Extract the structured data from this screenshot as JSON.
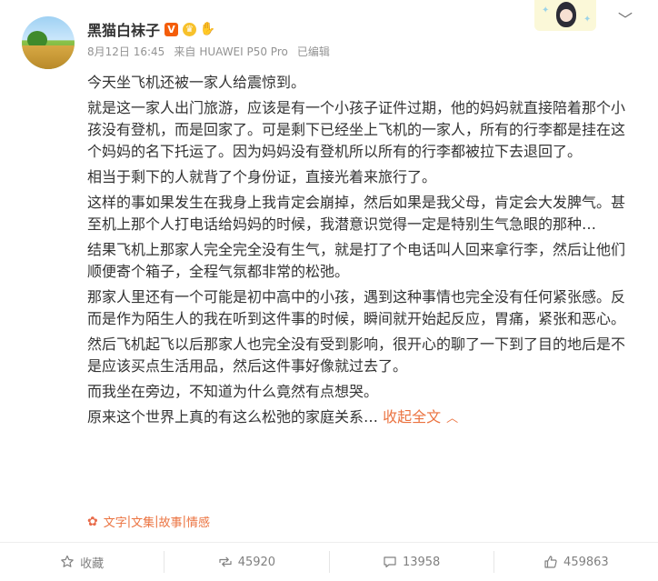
{
  "post": {
    "username": "黑猫白袜子",
    "date": "8月12日 16:45",
    "source_prefix": "来自",
    "device": "HUAWEI P50 Pro",
    "edited": "已编辑",
    "badges": [
      "verified-v-icon",
      "crown-badge-icon",
      "hand-badge-icon"
    ],
    "paragraphs": [
      "今天坐飞机还被一家人给震惊到。",
      "就是这一家人出门旅游，应该是有一个小孩子证件过期，他的妈妈就直接陪着那个小孩没有登机，而是回家了。可是剩下已经坐上飞机的一家人，所有的行李都是挂在这个妈妈的名下托运了。因为妈妈没有登机所以所有的行李都被拉下去退回了。",
      "相当于剩下的人就背了个身份证，直接光着来旅行了。",
      "这样的事如果发生在我身上我肯定会崩掉，然后如果是我父母，肯定会大发脾气。甚至机上那个人打电话给妈妈的时候，我潜意识觉得一定是特别生气急眼的那种…",
      "结果飞机上那家人完全完全没有生气，就是打了个电话叫人回来拿行李，然后让他们顺便寄个箱子，全程气氛都非常的松弛。",
      "那家人里还有一个可能是初中高中的小孩，遇到这种事情也完全没有任何紧张感。反而是作为陌生人的我在听到这件事的时候，瞬间就开始起反应，胃痛，紧张和恶心。",
      "然后飞机起飞以后那家人也完全没有受到影响，很开心的聊了一下到了目的地后是不是应该买点生活用品，然后这件事好像就过去了。",
      "而我坐在旁边，不知道为什么竟然有点想哭。"
    ],
    "last_line": "原来这个世界上真的有这么松弛的家庭关系…",
    "collapse_label": "收起全文"
  },
  "tags": {
    "items": [
      "文字",
      "文集",
      "故事",
      "情感"
    ],
    "separator": "|"
  },
  "actions": {
    "favorite_label": "收藏",
    "repost_count": "45920",
    "comment_count": "13958",
    "like_count": "459863"
  },
  "colors": {
    "accent": "#eb7340",
    "text": "#333333",
    "meta": "#939393",
    "verified": "#f45d0a"
  }
}
